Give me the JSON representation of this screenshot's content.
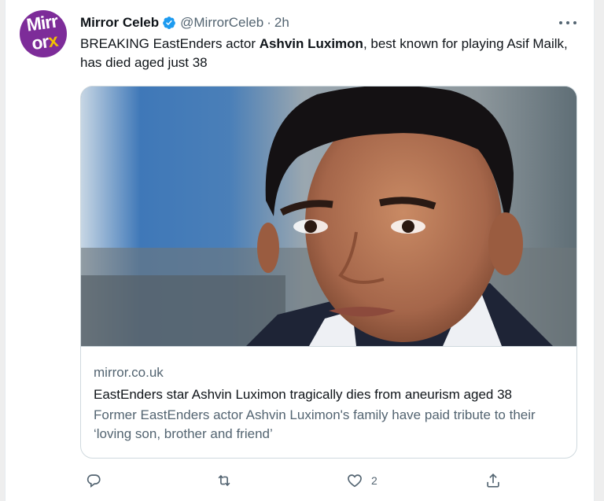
{
  "tweet": {
    "avatar_text_1": "Mirr",
    "avatar_text_2": "or",
    "avatar_text_3": "x",
    "display_name": "Mirror Celeb",
    "handle": "@MirrorCeleb",
    "separator": "·",
    "time": "2h",
    "text_part1": "BREAKING EastEnders actor ",
    "text_bold": "Ashvin Luximon",
    "text_part2": ", best known for playing Asif Mailk, has died aged just 38"
  },
  "card": {
    "domain": "mirror.co.uk",
    "title": "EastEnders star Ashvin Luximon tragically dies from aneurism aged 38",
    "description": "Former EastEnders actor Ashvin Luximon's family have paid tribute to their ‘loving son, brother and friend’"
  },
  "actions": {
    "reply_icon": "reply-icon",
    "retweet_icon": "retweet-icon",
    "like_icon": "heart-icon",
    "like_count": "2",
    "share_icon": "share-icon"
  },
  "colors": {
    "avatar_bg": "#7d2c99",
    "verified": "#1d9bf0",
    "text": "#0f1419",
    "muted": "#536471"
  }
}
